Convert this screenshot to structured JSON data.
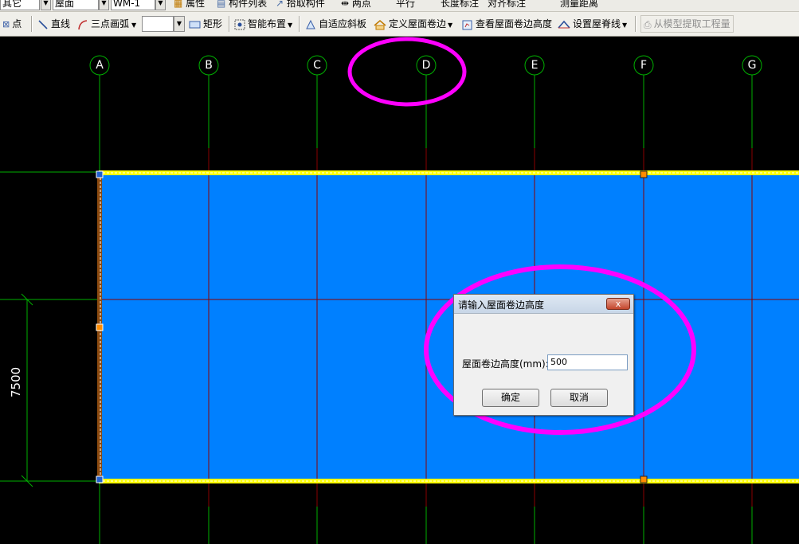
{
  "toolbar_top": {
    "combo1_value": "其它",
    "combo2_value": "屋面",
    "combo3_value": "WM-1",
    "items": [
      "属性",
      "构件列表",
      "拾取构件",
      "两点",
      "平行",
      "长度标注",
      "对齐标注",
      "测量距离"
    ]
  },
  "toolbar_main": {
    "point_label": "点",
    "line_label": "直线",
    "arc_label": "三点画弧",
    "rect_label": "矩形",
    "smart_layout_label": "智能布置",
    "adapt_slope_label": "自适应斜板",
    "define_roof_edge_label": "定义屋面卷边",
    "view_roof_edge_height_label": "查看屋面卷边高度",
    "set_ridge_label": "设置屋脊线",
    "extract_quantity_label": "从模型提取工程量"
  },
  "grid": {
    "axes": [
      "A",
      "B",
      "C",
      "D",
      "E",
      "F",
      "G"
    ],
    "dimension_label": "7500"
  },
  "colors": {
    "canvas_bg": "#000000",
    "roof_fill": "#0080ff",
    "grid_green": "#00b000",
    "grid_red": "#b00000",
    "edge_yellow": "#ffff00",
    "highlight_magenta": "#ff00ff"
  },
  "dialog": {
    "title": "请输入屋面卷边高度",
    "close_symbol": "x",
    "field_label": "屋面卷边高度(mm):",
    "field_value": "500",
    "ok_label": "确定",
    "cancel_label": "取消"
  }
}
